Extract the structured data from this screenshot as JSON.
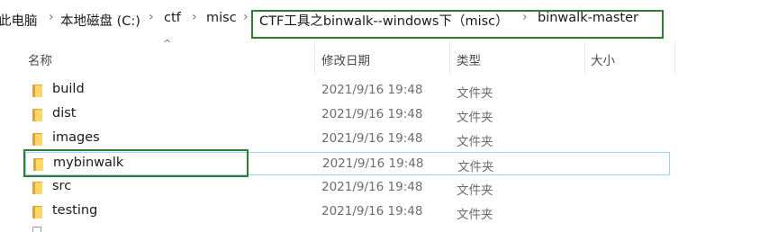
{
  "breadcrumbs": [
    {
      "label": "此电脑"
    },
    {
      "label": "本地磁盘 (C:)"
    },
    {
      "label": "ctf"
    },
    {
      "label": "misc"
    },
    {
      "label": "CTF工具之binwalk--windows下（misc）"
    },
    {
      "label": "binwalk-master"
    }
  ],
  "columns": {
    "name": "名称",
    "date": "修改日期",
    "type": "类型",
    "size": "大小"
  },
  "rows": [
    {
      "name": "build",
      "date": "2021/9/16 19:48",
      "type": "文件夹"
    },
    {
      "name": "dist",
      "date": "2021/9/16 19:48",
      "type": "文件夹"
    },
    {
      "name": "images",
      "date": "2021/9/16 19:48",
      "type": "文件夹"
    },
    {
      "name": "mybinwalk",
      "date": "2021/9/16 19:48",
      "type": "文件夹"
    },
    {
      "name": "src",
      "date": "2021/9/16 19:48",
      "type": "文件夹"
    },
    {
      "name": "testing",
      "date": "2021/9/16 19:48",
      "type": "文件夹"
    }
  ],
  "colors": {
    "highlight_box": "#2e7d32",
    "selection_border": "#99d1ff",
    "folder": "#ffd766"
  }
}
